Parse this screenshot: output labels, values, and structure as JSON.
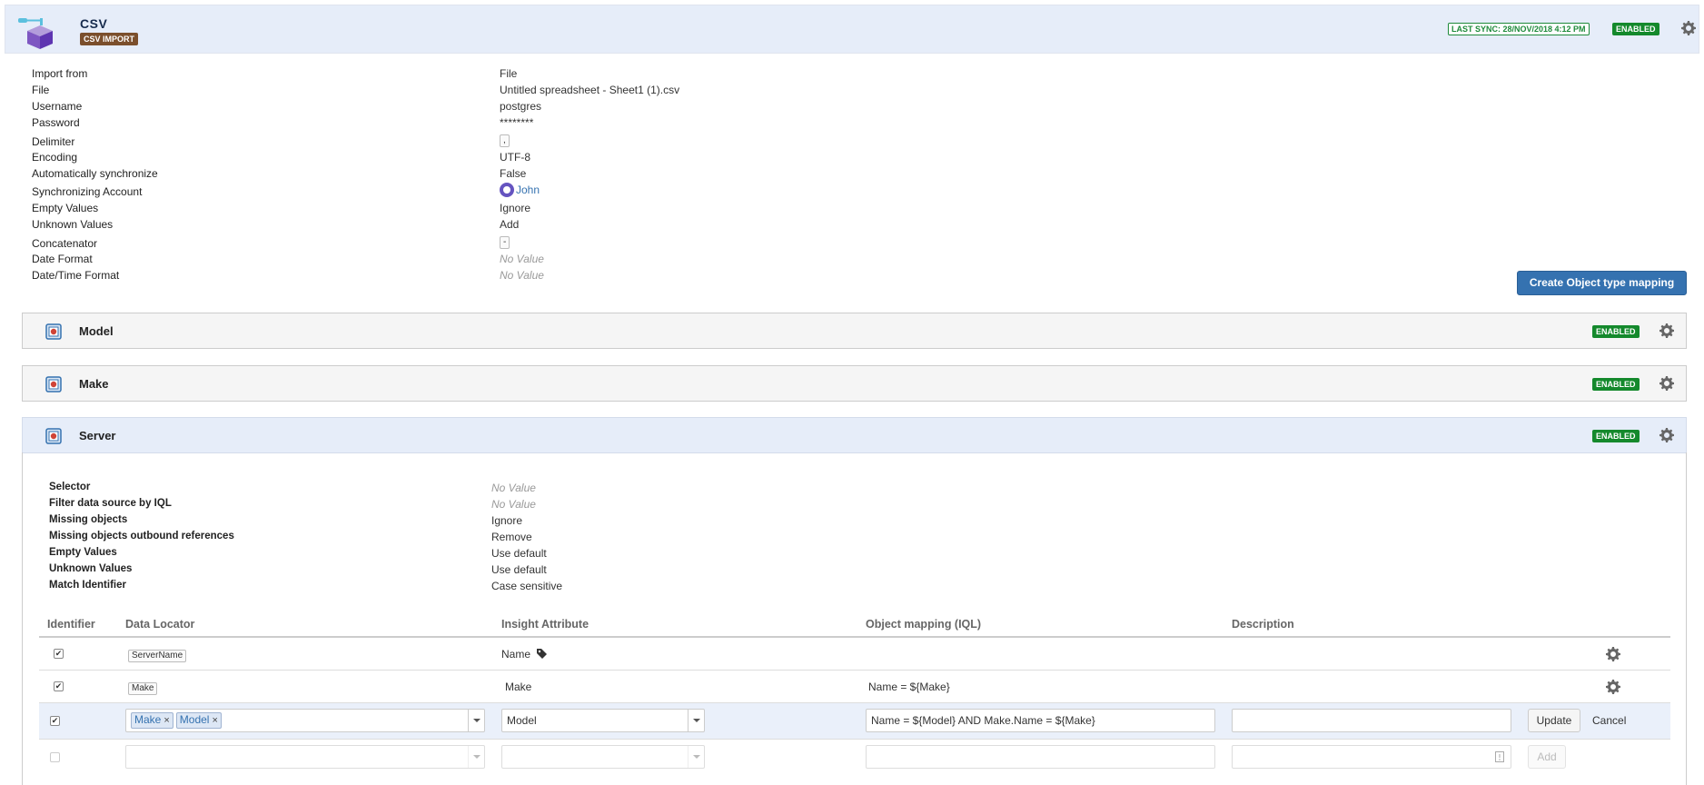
{
  "header": {
    "title": "CSV",
    "type_badge": "CSV IMPORT",
    "last_sync": "LAST SYNC: 28/NOV/2018 4:12 PM",
    "status": "ENABLED"
  },
  "import_props": [
    {
      "key": "Import from",
      "value": "File"
    },
    {
      "key": "File",
      "value": "Untitled spreadsheet - Sheet1 (1).csv"
    },
    {
      "key": "Username",
      "value": "postgres"
    },
    {
      "key": "Password",
      "value": "********"
    },
    {
      "key": "Delimiter",
      "value": ","
    },
    {
      "key": "Encoding",
      "value": "UTF-8"
    },
    {
      "key": "Automatically synchronize",
      "value": "False"
    },
    {
      "key": "Synchronizing Account",
      "value": "John"
    },
    {
      "key": "Empty Values",
      "value": "Ignore"
    },
    {
      "key": "Unknown Values",
      "value": "Add"
    },
    {
      "key": "Concatenator",
      "value": "-"
    },
    {
      "key": "Date Format",
      "value": "No Value"
    },
    {
      "key": "Date/Time Format",
      "value": "No Value"
    }
  ],
  "create_mapping_button": "Create Object type mapping",
  "mappings": [
    {
      "name": "Model",
      "status": "ENABLED"
    },
    {
      "name": "Make",
      "status": "ENABLED"
    },
    {
      "name": "Server",
      "status": "ENABLED"
    }
  ],
  "server_props": [
    {
      "key": "Selector",
      "value": "No Value"
    },
    {
      "key": "Filter data source by IQL",
      "value": "No Value"
    },
    {
      "key": "Missing objects",
      "value": "Ignore"
    },
    {
      "key": "Missing objects outbound references",
      "value": "Remove"
    },
    {
      "key": "Empty Values",
      "value": "Use default"
    },
    {
      "key": "Unknown Values",
      "value": "Use default"
    },
    {
      "key": "Match Identifier",
      "value": "Case sensitive"
    }
  ],
  "table": {
    "headers": {
      "identifier": "Identifier",
      "data_locator": "Data Locator",
      "insight_attribute": "Insight Attribute",
      "object_mapping": "Object mapping (IQL)",
      "description": "Description"
    },
    "rows": [
      {
        "locator": "ServerName",
        "attribute": "Name",
        "iql": ""
      },
      {
        "locator": "Make",
        "attribute": "Make",
        "iql": "Name = ${Make}"
      }
    ],
    "edit_row": {
      "tags": [
        "Make",
        "Model"
      ],
      "attribute": "Model",
      "iql": "Name = ${Model} AND Make.Name = ${Make}",
      "description": "",
      "update_label": "Update",
      "cancel_label": "Cancel"
    },
    "new_row": {
      "add_label": "Add"
    }
  }
}
